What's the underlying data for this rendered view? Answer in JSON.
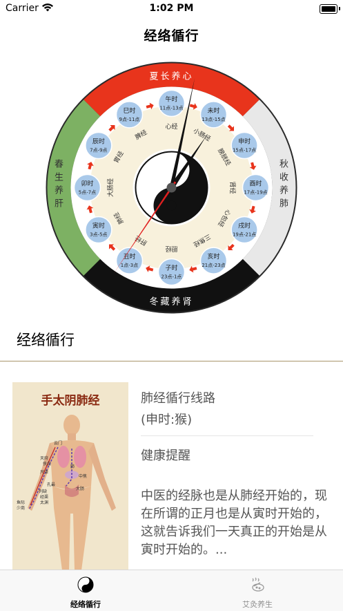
{
  "status_bar": {
    "carrier": "Carrier",
    "time": "1:02 PM"
  },
  "nav": {
    "title": "经络循行"
  },
  "clock": {
    "seasons": {
      "top": "夏长养心",
      "right": "秋收养肺",
      "bottom": "冬藏养肾",
      "left": "春生养肝"
    },
    "season_colors": {
      "top": "#e8341c",
      "right": "#e8e8e8",
      "bottom": "#111111",
      "left": "#7db163"
    },
    "hours": [
      {
        "name": "午时",
        "range": "11点-13点"
      },
      {
        "name": "未时",
        "range": "13点-15点"
      },
      {
        "name": "申时",
        "range": "15点-17点"
      },
      {
        "name": "酉时",
        "range": "17点-19点"
      },
      {
        "name": "戌时",
        "range": "19点-21点"
      },
      {
        "name": "亥时",
        "range": "21点-23点"
      },
      {
        "name": "子时",
        "range": "23点-1点"
      },
      {
        "name": "丑时",
        "range": "1点-3点"
      },
      {
        "name": "寅时",
        "range": "3点-5点"
      },
      {
        "name": "卯时",
        "range": "5点-7点"
      },
      {
        "name": "辰时",
        "range": "7点-9点"
      },
      {
        "name": "巳时",
        "range": "9点-11点"
      }
    ],
    "meridians": [
      "心经",
      "小肠经",
      "膀胱经",
      "肾经",
      "心包经",
      "三焦经",
      "胆经",
      "肝经",
      "肺经",
      "大肠经",
      "胃经",
      "脾经"
    ],
    "hands": {
      "hour": "1:02",
      "second_color": "#e02020"
    }
  },
  "section": {
    "title": "经络循行"
  },
  "card": {
    "image_title": "手太阴肺经",
    "heading": "肺经循行线路",
    "subheading": "(申时:猴)",
    "reminder_title": "健康提醒",
    "body": "中医的经脉也是从肺经开始的，现在所谓的正月也是从寅时开始的，这就告诉我们一天真正的开始是从寅时开始的。..."
  },
  "tabs": [
    {
      "label": "经络循行",
      "icon": "yin-yang-icon",
      "active": true
    },
    {
      "label": "艾灸养生",
      "icon": "moxibustion-icon",
      "active": false
    }
  ]
}
